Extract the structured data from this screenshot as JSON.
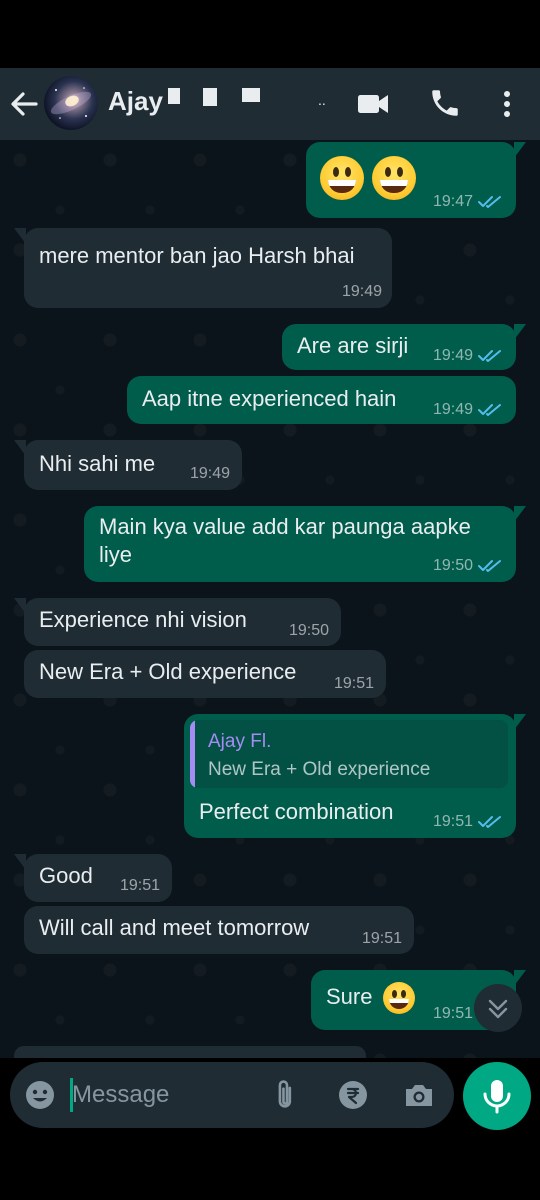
{
  "header": {
    "contact_name": "Ajay",
    "name_suffix": ".."
  },
  "messages": [
    {
      "dir": "out",
      "text": "",
      "time": "19:47",
      "read": true,
      "emoji": [
        "grinning-face",
        "grinning-face"
      ]
    },
    {
      "dir": "in",
      "text": "mere mentor ban jao Harsh bhai",
      "time": "19:49"
    },
    {
      "dir": "out",
      "text": "Are are sirji",
      "time": "19:49",
      "read": true
    },
    {
      "dir": "out",
      "text": "Aap itne experienced hain",
      "time": "19:49",
      "read": true
    },
    {
      "dir": "in",
      "text": "Nhi sahi me",
      "time": "19:49"
    },
    {
      "dir": "out",
      "text": "Main kya value add kar paunga aapke",
      "text_line2": "liye",
      "time": "19:50",
      "read": true
    },
    {
      "dir": "in",
      "text": "Experience nhi vision",
      "time": "19:50"
    },
    {
      "dir": "in",
      "text": "New Era + Old experience",
      "time": "19:51"
    },
    {
      "dir": "out",
      "text": "Perfect combination",
      "time": "19:51",
      "read": true,
      "quote": {
        "author": "Ajay Fl.",
        "text": "New Era + Old experience"
      }
    },
    {
      "dir": "in",
      "text": "Good",
      "time": "19:51"
    },
    {
      "dir": "in",
      "text": "Will call and meet tomorrow",
      "time": "19:51"
    },
    {
      "dir": "out",
      "text": "Sure",
      "time": "19:51",
      "read": true,
      "emoji": [
        "grinning-face"
      ]
    }
  ],
  "input": {
    "placeholder": "Message",
    "value": ""
  },
  "icons": {
    "back": "arrow-left-icon",
    "video": "video-camera-icon",
    "call": "phone-icon",
    "menu": "more-vertical-icon",
    "emoji": "emoji-icon",
    "attach": "paperclip-icon",
    "payment": "rupee-icon",
    "camera": "camera-icon",
    "mic": "microphone-icon",
    "scroll": "chevrons-down-icon"
  },
  "colors": {
    "header_bg": "#1f2c34",
    "chat_bg": "#0b141a",
    "incoming_bubble": "#1f2c34",
    "outgoing_bubble": "#005c4b",
    "accent": "#00a884",
    "read_ticks": "#53bdeb",
    "quote_author": "#a58cf3"
  }
}
